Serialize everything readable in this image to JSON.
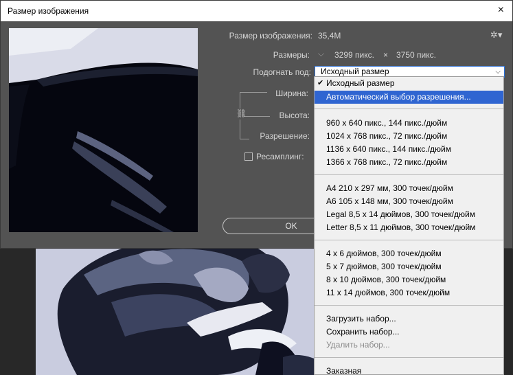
{
  "window": {
    "title": "Размер изображения",
    "close_icon": "×"
  },
  "info": {
    "image_size_label": "Размер изображения:",
    "image_size_value": "35,4M",
    "dimensions_label": "Размеры:",
    "dimensions_width": "3299 пикс.",
    "dimensions_times": "×",
    "dimensions_height": "3750 пикс.",
    "fit_label": "Подогнать под:",
    "fit_value": "Исходный размер"
  },
  "fields": {
    "width_label": "Ширина:",
    "height_label": "Высота:",
    "resolution_label": "Разрешение:",
    "resample_label": "Ресамплинг:"
  },
  "buttons": {
    "ok": "OK"
  },
  "dropdown": {
    "original": "Исходный размер",
    "auto": "Автоматический выбор разрешения...",
    "screen_presets": [
      "960 x 640 пикс., 144 пикс./дюйм",
      "1024 x 768 пикс., 72 пикс./дюйм",
      "1136 x 640 пикс., 144 пикс./дюйм",
      "1366 x 768 пикс., 72 пикс./дюйм"
    ],
    "paper_presets": [
      "A4 210 x 297 мм, 300 точек/дюйм",
      "A6 105 x 148 мм, 300 точек/дюйм",
      "Legal 8,5 x 14 дюймов, 300 точек/дюйм",
      "Letter 8,5 x 11 дюймов, 300 точек/дюйм"
    ],
    "photo_presets": [
      "4 x 6 дюймов, 300 точек/дюйм",
      "5 x 7 дюймов, 300 точек/дюйм",
      "8 x 10 дюймов, 300 точек/дюйм",
      "11 x 14 дюймов, 300 точек/дюйм"
    ],
    "load": "Загрузить набор...",
    "save": "Сохранить набор...",
    "delete": "Удалить набор...",
    "custom": "Заказная"
  },
  "colors": {
    "dialog_bg": "#535353",
    "highlight": "#2f65d1",
    "menu_bg": "#f0f0f0"
  }
}
